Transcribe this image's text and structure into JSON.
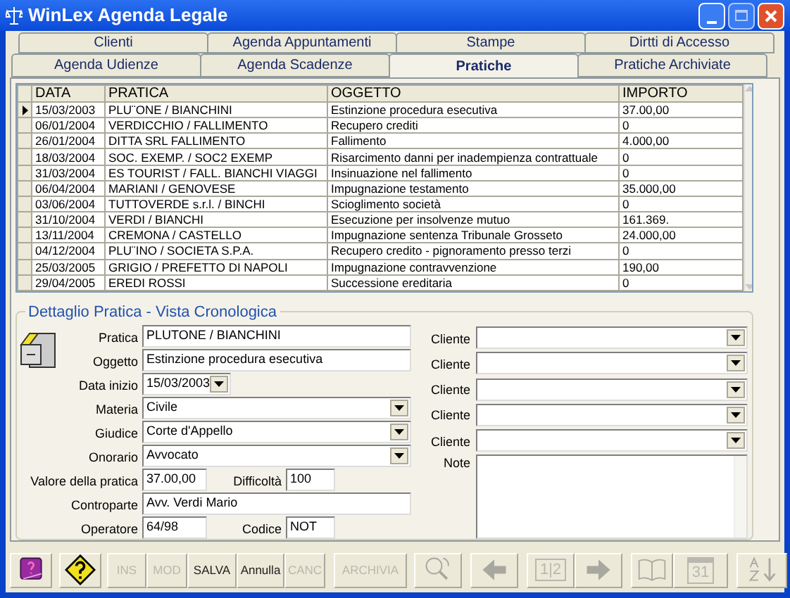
{
  "window": {
    "title": "WinLex Agenda Legale"
  },
  "tab_rows": [
    [
      {
        "label": "Clienti",
        "selected": false
      },
      {
        "label": "Agenda Appuntamenti",
        "selected": false
      },
      {
        "label": "Stampe",
        "selected": false
      },
      {
        "label": "Dirtti di Accesso",
        "selected": false
      }
    ],
    [
      {
        "label": "Agenda Udienze",
        "selected": false
      },
      {
        "label": "Agenda Scadenze",
        "selected": false
      },
      {
        "label": "Pratiche",
        "selected": true
      },
      {
        "label": "Pratiche Archiviate",
        "selected": false
      }
    ]
  ],
  "table": {
    "columns": [
      "DATA",
      "PRATICA",
      "OGGETTO",
      "IMPORTO"
    ],
    "rows": [
      {
        "cells": [
          "15/03/2003",
          "PLU¨ONE / BIANCHINI",
          "Estinzione procedura esecutiva",
          "37.00,00"
        ],
        "current": true
      },
      {
        "cells": [
          "06/01/2004",
          "VERDICCHIO / FALLIMENTO",
          "Recupero crediti",
          "0"
        ],
        "current": false
      },
      {
        "cells": [
          "26/01/2004",
          "DITTA SRL FALLIMENTO",
          "Fallimento",
          "4.000,00"
        ],
        "current": false
      },
      {
        "cells": [
          "18/03/2004",
          "SOC. EXEMP. / SOC2 EXEMP",
          "Risarcimento danni per inadempienza contrattuale",
          "0"
        ],
        "current": false
      },
      {
        "cells": [
          "31/03/2004",
          "ES TOURIST / FALL. BIANCHI VIAGGI",
          "Insinuazione nel fallimento",
          "0"
        ],
        "current": false
      },
      {
        "cells": [
          "06/04/2004",
          "MARIANI / GENOVESE",
          "Impugnazione testamento",
          "35.000,00"
        ],
        "current": false
      },
      {
        "cells": [
          "03/06/2004",
          "TUTTOVERDE s.r.l. / BINCHI",
          "Scioglimento società",
          "0"
        ],
        "current": false
      },
      {
        "cells": [
          "31/10/2004",
          "VERDI / BIANCHI",
          "Esecuzione per insolvenze mutuo",
          "161.369."
        ],
        "current": false
      },
      {
        "cells": [
          "13/11/2004",
          "CREMONA / CASTELLO",
          "Impugnazione sentenza Tribunale Grosseto",
          "24.000,00"
        ],
        "current": false
      },
      {
        "cells": [
          "04/12/2004",
          "PLU¨INO / SOCIETA S.P.A.",
          "Recupero credito - pignoramento presso terzi",
          "0"
        ],
        "current": false
      },
      {
        "cells": [
          "25/03/2005",
          "GRIGIO / PREFETTO DI NAPOLI",
          "Impugnazione contravvenzione",
          "190,00"
        ],
        "current": false
      },
      {
        "cells": [
          "29/04/2005",
          "EREDI ROSSI",
          "Successione ereditaria",
          "0"
        ],
        "current": false
      }
    ]
  },
  "detail": {
    "title": "Dettaglio Pratica - Vista Cronologica",
    "fields": [
      {
        "label": "Pratica",
        "value": "PLUTONE / BIANCHINI",
        "kind": "text"
      },
      {
        "label": "Oggetto",
        "value": "Estinzione procedura esecutiva",
        "kind": "text"
      },
      {
        "label": "Data inizio",
        "value": "15/03/2003",
        "kind": "date"
      },
      {
        "label": "Materia",
        "value": "Civile",
        "kind": "combo"
      },
      {
        "label": "Giudice",
        "value": "Corte d'Appello",
        "kind": "combo"
      },
      {
        "label": "Onorario",
        "value": "Avvocato",
        "kind": "combo"
      },
      {
        "label": "Valore della pratica",
        "value": "37.00,00",
        "kind": "pair",
        "label2": "Difficoltà",
        "value2": "100"
      },
      {
        "label": "Controparte",
        "value": "Avv. Verdi Mario",
        "kind": "text"
      },
      {
        "label": "Operatore",
        "value": "64/98",
        "kind": "pair",
        "label2": "Codice",
        "value2": "NOT"
      }
    ],
    "clients": [
      "Cliente",
      "Cliente",
      "Cliente",
      "Cliente",
      "Cliente"
    ],
    "note_label": "Note"
  },
  "toolbar": [
    {
      "kind": "book"
    },
    {
      "kind": "help"
    },
    {
      "kind": "text",
      "label": "INS",
      "disabled": true
    },
    {
      "kind": "text",
      "label": "MOD",
      "disabled": true
    },
    {
      "kind": "text",
      "label": "SALVA",
      "disabled": false
    },
    {
      "kind": "text",
      "label": "Annulla",
      "disabled": false
    },
    {
      "kind": "text",
      "label": "CANC",
      "disabled": true
    },
    {
      "kind": "text",
      "label": "ARCHIVIA",
      "disabled": true
    },
    {
      "kind": "search",
      "disabled": true
    },
    {
      "kind": "prev",
      "disabled": true
    },
    {
      "kind": "pages",
      "label": "1|2",
      "disabled": true
    },
    {
      "kind": "next",
      "disabled": true
    },
    {
      "kind": "openbook",
      "disabled": true
    },
    {
      "kind": "calendar",
      "label": "31",
      "disabled": true
    },
    {
      "kind": "sort",
      "disabled": true
    }
  ]
}
